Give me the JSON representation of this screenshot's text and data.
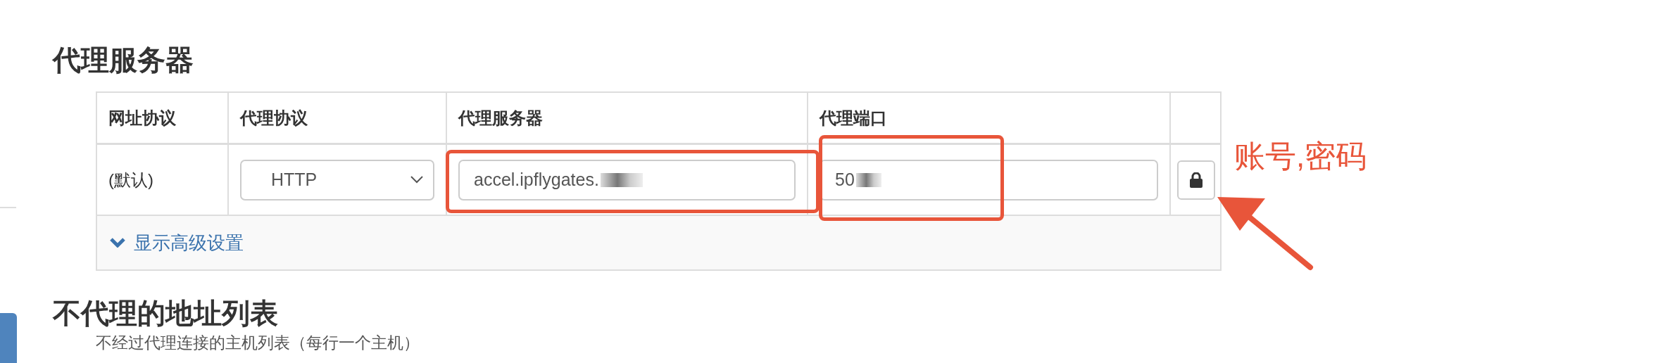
{
  "proxy_section": {
    "title": "代理服务器",
    "table": {
      "columns": [
        "网址协议",
        "代理协议",
        "代理服务器",
        "代理端口"
      ],
      "rows": [
        {
          "url_protocol": "(默认)",
          "proxy_protocol": "HTTP",
          "proxy_server": "accel.ipflygates.",
          "proxy_port": "50"
        }
      ]
    },
    "advanced": {
      "label": "显示高级设置",
      "expanded": false
    }
  },
  "annotation": {
    "text": "账号,密码"
  },
  "bypass_section": {
    "title": "不代理的地址列表",
    "description": "不经过代理连接的主机列表（每行一个主机）"
  }
}
